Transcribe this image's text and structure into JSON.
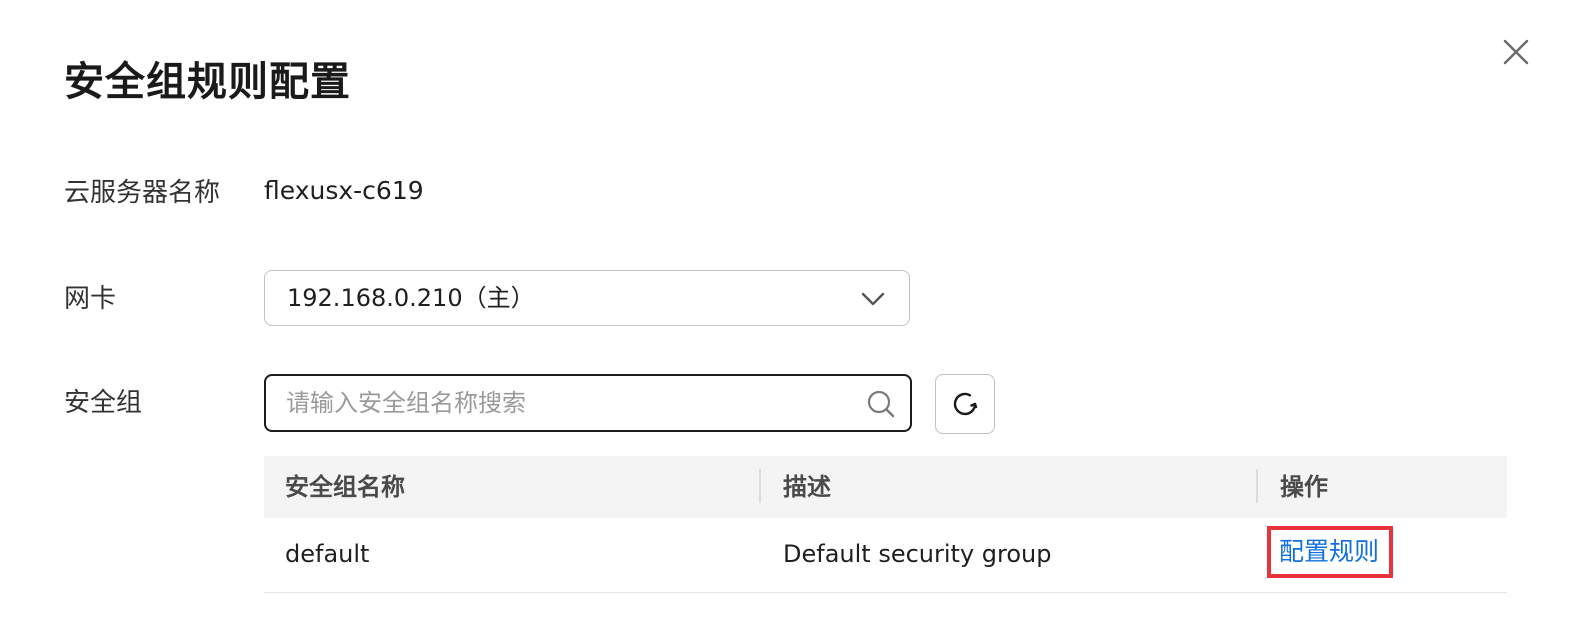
{
  "dialog": {
    "title": "安全组规则配置"
  },
  "form": {
    "server_name_label": "云服务器名称",
    "server_name_value": "flexusx-c619",
    "nic_label": "网卡",
    "nic_selected": "192.168.0.210（主）",
    "security_group_label": "安全组",
    "search_placeholder": "请输入安全组名称搜索",
    "search_value": ""
  },
  "table": {
    "columns": [
      "安全组名称",
      "描述",
      "操作"
    ],
    "rows": [
      {
        "name": "default",
        "description": "Default security group",
        "action": "配置规则"
      }
    ]
  },
  "icons": {
    "close": "close-icon",
    "chevron": "chevron-down-icon",
    "search": "search-icon",
    "refresh": "refresh-icon"
  },
  "colors": {
    "link": "#1170e0",
    "highlight_border": "#e8333c",
    "header_bg": "#f4f4f4"
  }
}
